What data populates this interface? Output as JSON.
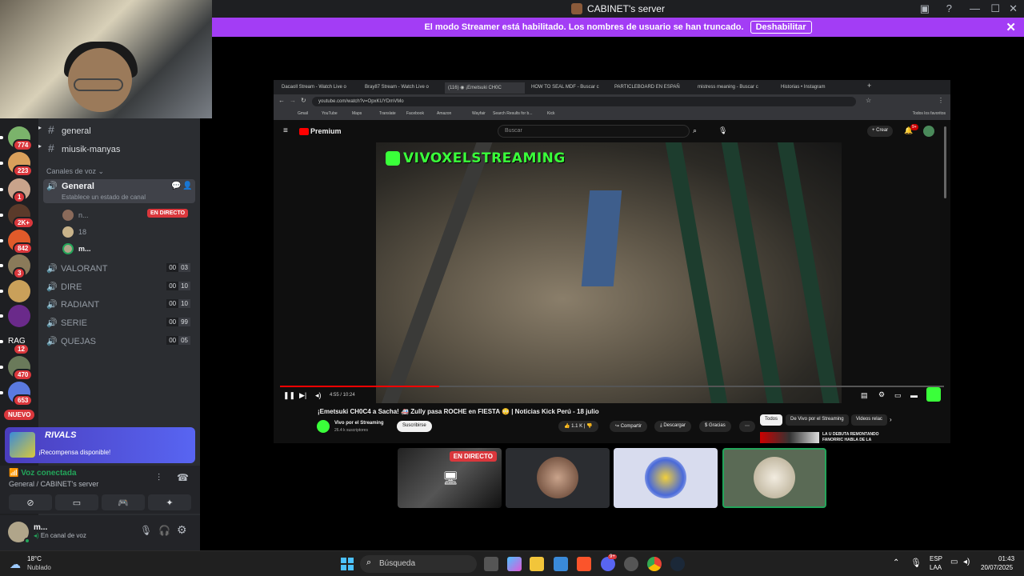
{
  "window": {
    "title": "CABINET's server",
    "controls": [
      "—",
      "☐",
      "✕"
    ]
  },
  "banner": {
    "text": "El modo Streamer está habilitado. Los nombres de usuario se han truncado.",
    "button": "Deshabilitar"
  },
  "guilds": [
    {
      "badge": "774",
      "color": "#7bb36b"
    },
    {
      "badge": "223",
      "color": "#d9a05b"
    },
    {
      "badge": "1",
      "color": "#c9a38b"
    },
    {
      "badge": "2K+",
      "color": "#5a3a2a"
    },
    {
      "badge": "842",
      "color": "#e05a2a"
    },
    {
      "badge": "3",
      "color": "#8a7a5a"
    },
    {
      "badge": "",
      "color": "#c9a05a"
    },
    {
      "badge": "",
      "color": "#6a2a8a"
    },
    {
      "badge": "12",
      "color": "#3a3a3a",
      "label": "RAG"
    },
    {
      "badge": "470",
      "color": "#6a7a5a"
    },
    {
      "badge": "653",
      "color": "#5a7ae0"
    }
  ],
  "guild_new_label": "NUEVO",
  "text_channels": [
    {
      "name": "general"
    },
    {
      "name": "miusik-manyas"
    }
  ],
  "voice_category": "Canales de voz",
  "general_voice": {
    "name": "General",
    "status": "Establece un estado de canal",
    "users": [
      {
        "name": "n...",
        "live": "EN DIRECTO"
      },
      {
        "name": "18"
      },
      {
        "name": "m..."
      }
    ]
  },
  "voice_channels": [
    {
      "name": "VALORANT",
      "count": "00",
      "limit": "03"
    },
    {
      "name": "DIRE",
      "count": "00",
      "limit": "10"
    },
    {
      "name": "RADIANT",
      "count": "00",
      "limit": "10"
    },
    {
      "name": "SERIE",
      "count": "00",
      "limit": "99"
    },
    {
      "name": "QUEJAS",
      "count": "00",
      "limit": "05"
    }
  ],
  "promo": {
    "game": "RIVALS",
    "text": "¡Recompensa disponible!"
  },
  "voice_status": {
    "title": "Voz conectada",
    "location": "General / CABINET's server"
  },
  "user_panel": {
    "name": "m...",
    "status": "En canal de voz"
  },
  "browser": {
    "tabs": [
      "Dacaoll Stream - Watch Live o",
      "Bray87 Stream - Watch Live o",
      "(116) ◉ ¡Emetsuki CH0C",
      "HOW TO SEAL MDF - Buscar c",
      "PARTICLEBOARD EN ESPAÑ",
      "mistress meaning - Buscar c",
      "Historias • Instagram"
    ],
    "url": "youtube.com/watch?v=OpxKUYDmVMo",
    "bookmarks": [
      "Gmail",
      "YouTube",
      "Maps",
      "Translate",
      "Facebook",
      "Amazon",
      "Wayfair",
      "Search Results for b...",
      "Kick"
    ],
    "bookmarks_right": "Todos los favoritos"
  },
  "youtube": {
    "logo": "Premium",
    "search_placeholder": "Buscar",
    "create": "Crear",
    "notif_count": "9+",
    "overlay": "VIVOXELSTREAMING",
    "time": "4:55 / 10:24",
    "title": "¡Emetsuki CH0C4 a Sacha! 🚑 Zully pasa ROCHE en FIESTA 😳 | Noticias Kick Perú - 18 julio",
    "channel": "Vivo por el Streaming",
    "subs": "26.4 k suscriptores",
    "subscribe": "Suscribirse",
    "likes": "1.1 K",
    "share": "Compartir",
    "download": "Descargar",
    "thanks": "Gracias",
    "chips": [
      "Todos",
      "De Vivo por el Streaming",
      "Videos relac"
    ],
    "side_title": "LA U DEBUTA REMONTANDO FANORRIC HABLA DE LA"
  },
  "stream_tiles": {
    "live": "EN DIRECTO"
  },
  "taskbar": {
    "weather_temp": "18°C",
    "weather_desc": "Nublado",
    "search": "Búsqueda",
    "lang": "ESP",
    "region": "LAA",
    "time": "01:43",
    "date": "20/07/2025",
    "discord_badge": "9+"
  }
}
